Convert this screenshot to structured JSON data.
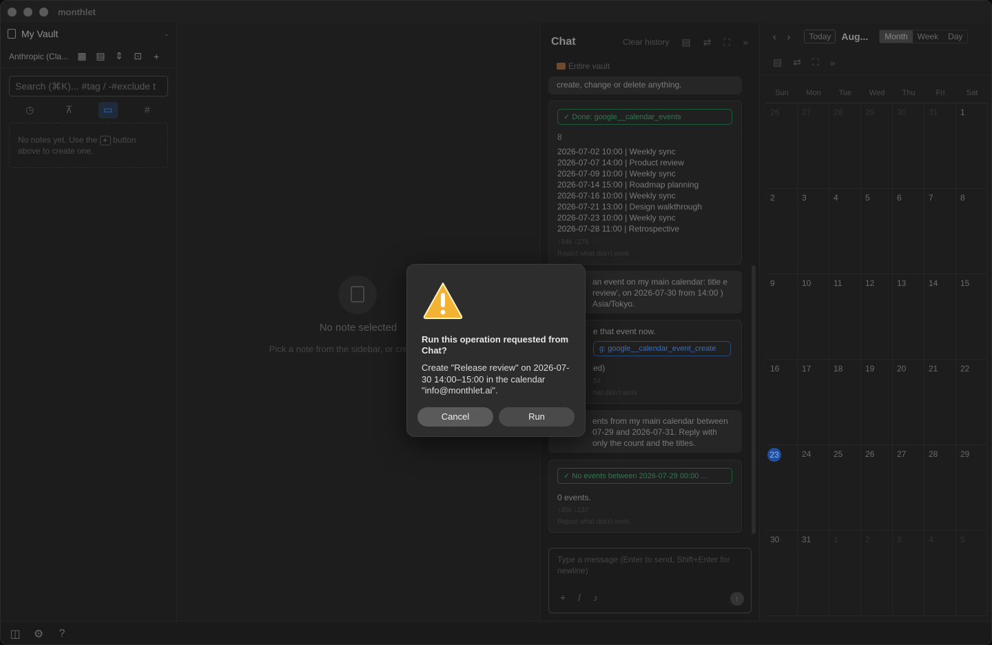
{
  "app": {
    "title": "monthlet"
  },
  "sidebar": {
    "vault_name": "My Vault",
    "model": "Anthropic (Cla...",
    "search_placeholder": "Search (⌘K)... #tag / -#exclude t",
    "empty_pre": "No notes yet. Use the",
    "empty_plus": "+",
    "empty_post": "button above to create one."
  },
  "main": {
    "title": "No note selected",
    "subtitle": "Pick a note from the sidebar, or create a chat"
  },
  "chat": {
    "title": "Chat",
    "clear_label": "Clear history",
    "scope": "Entire vault",
    "top_fragment": "create, change or delete anything.",
    "card1": {
      "status": "✓  Done: google__calendar_events",
      "count": "8",
      "events": [
        "2026-07-02 10:00 | Weekly sync",
        "2026-07-07 14:00 | Product review",
        "2026-07-09 10:00 | Weekly sync",
        "2026-07-14 15:00 | Roadmap planning",
        "2026-07-16 10:00 | Weekly sync",
        "2026-07-21 13:00 | Design walkthrough",
        "2026-07-23 10:00 | Weekly sync",
        "2026-07-28 11:00 | Retrospective"
      ],
      "tokens": "↑34k ↓276",
      "report": "Report what didn't work"
    },
    "msg1": "an event on my main calendar: title e review', on 2026-07-30 from 14:00 ) Asia/Tokyo.",
    "card2": {
      "text": "e that event now.",
      "status": "g: google__calendar_event_create",
      "line": "ed)",
      "tokens": "54",
      "report": "hat didn't work"
    },
    "msg2": "ents from my main calendar between 07-29 and 2026-07-31. Reply with only the count and the titles.",
    "card3": {
      "status": "✓  No events between 2026-07-29 00:00 ...",
      "count": "0 events.",
      "tokens": "↑35k ↓137",
      "report": "Report what didn't work"
    },
    "input_placeholder": "Type a message (Enter to send, Shift+Enter for newline)"
  },
  "calendar": {
    "today_label": "Today",
    "month_label": "Aug...",
    "views": [
      "Month",
      "Week",
      "Day"
    ],
    "weekdays": [
      "Sun",
      "Mon",
      "Tue",
      "Wed",
      "Thu",
      "Fri",
      "Sat"
    ],
    "days": [
      [
        "26",
        "27",
        "28",
        "29",
        "30",
        "31",
        "1"
      ],
      [
        "2",
        "3",
        "4",
        "5",
        "6",
        "7",
        "8"
      ],
      [
        "9",
        "10",
        "11",
        "12",
        "13",
        "14",
        "15"
      ],
      [
        "16",
        "17",
        "18",
        "19",
        "20",
        "21",
        "22"
      ],
      [
        "23",
        "24",
        "25",
        "26",
        "27",
        "28",
        "29"
      ],
      [
        "30",
        "31",
        "1",
        "2",
        "3",
        "4",
        "5"
      ]
    ],
    "today_day": "23"
  },
  "dialog": {
    "title": "Run this operation requested from Chat?",
    "body": "Create \"Release review\" on 2026-07-30 14:00–15:00 in the calendar \"info@monthlet.ai\".",
    "cancel": "Cancel",
    "run": "Run"
  }
}
